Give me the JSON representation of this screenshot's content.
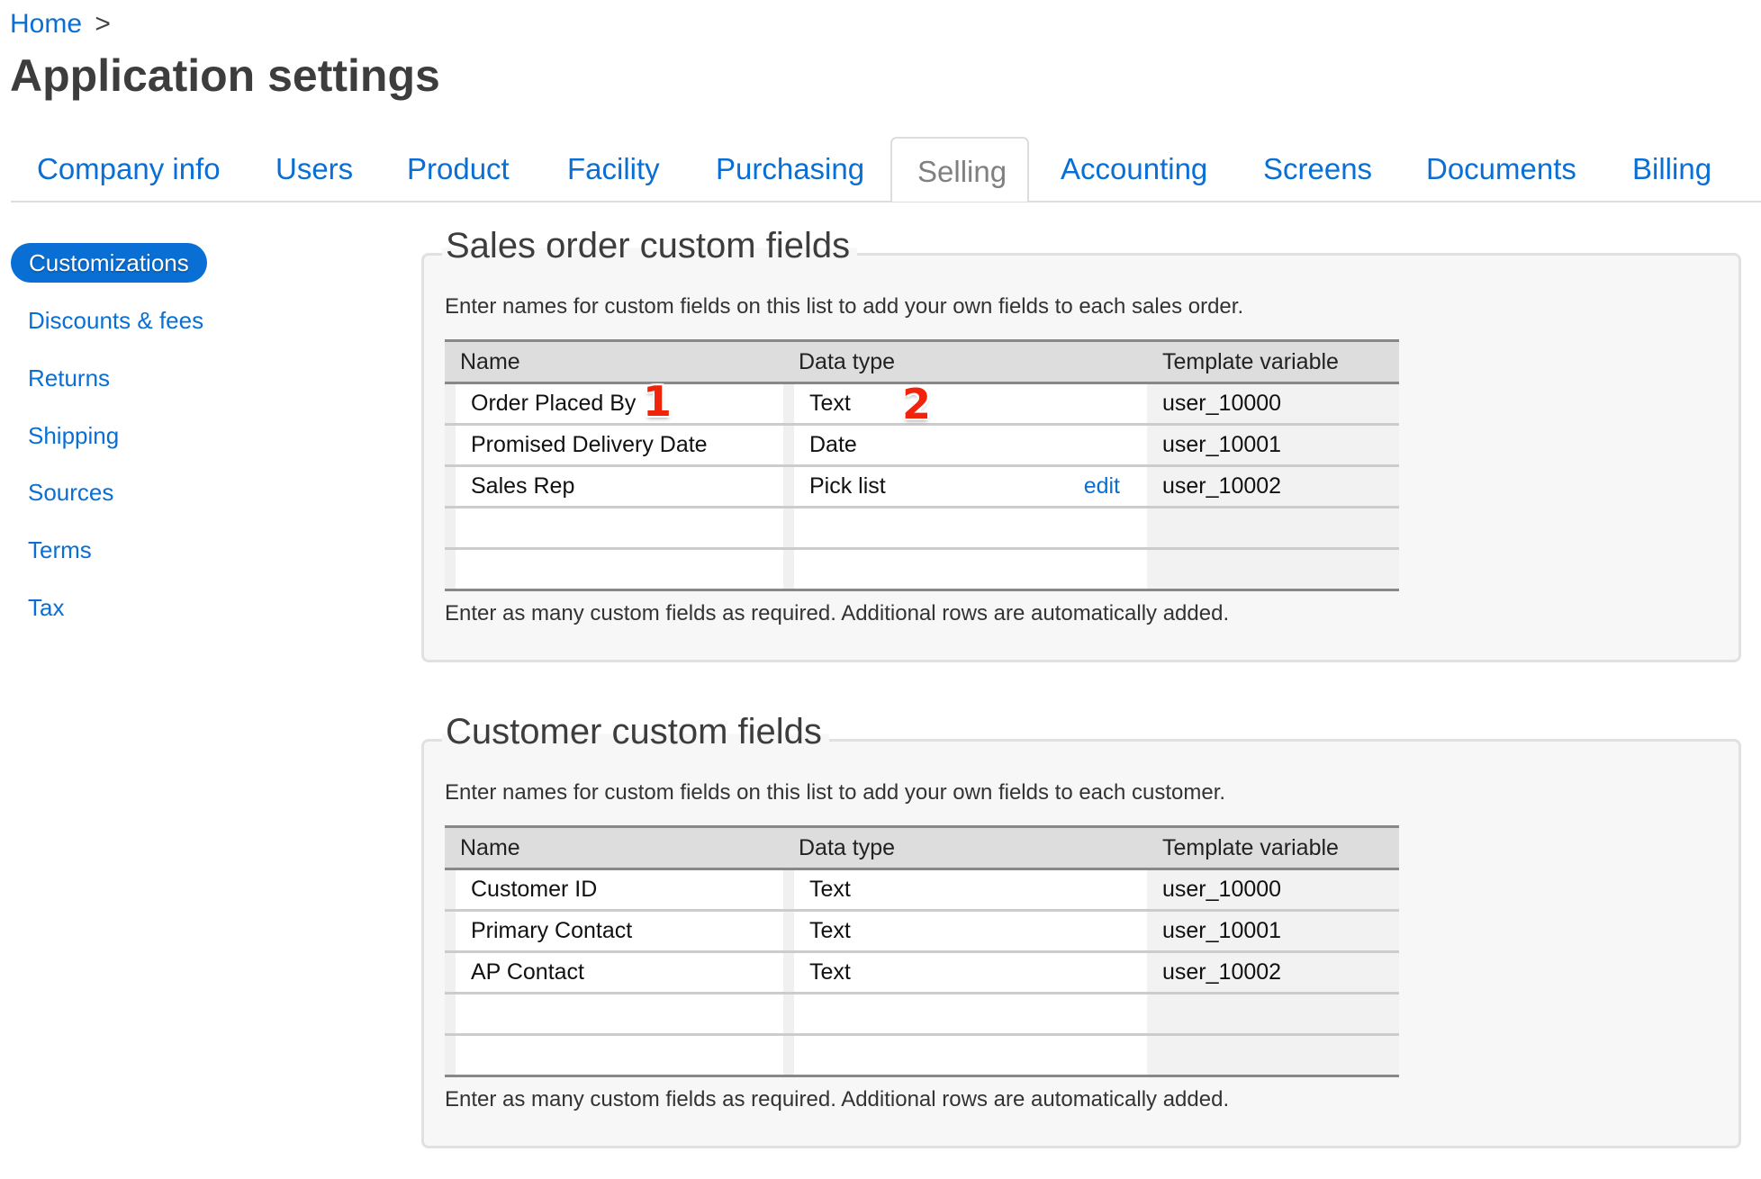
{
  "breadcrumb": {
    "home": "Home",
    "separator": ">"
  },
  "page_title": "Application settings",
  "tabs": [
    {
      "label": "Company info",
      "active": false
    },
    {
      "label": "Users",
      "active": false
    },
    {
      "label": "Product",
      "active": false
    },
    {
      "label": "Facility",
      "active": false
    },
    {
      "label": "Purchasing",
      "active": false
    },
    {
      "label": "Selling",
      "active": true
    },
    {
      "label": "Accounting",
      "active": false
    },
    {
      "label": "Screens",
      "active": false
    },
    {
      "label": "Documents",
      "active": false
    },
    {
      "label": "Billing",
      "active": false
    }
  ],
  "sidebar": {
    "items": [
      {
        "label": "Customizations",
        "active": true
      },
      {
        "label": "Discounts & fees",
        "active": false
      },
      {
        "label": "Returns",
        "active": false
      },
      {
        "label": "Shipping",
        "active": false
      },
      {
        "label": "Sources",
        "active": false
      },
      {
        "label": "Terms",
        "active": false
      },
      {
        "label": "Tax",
        "active": false
      }
    ]
  },
  "sales_order_fields": {
    "title": "Sales order custom fields",
    "description": "Enter names for custom fields on this list to add your own fields to each sales order.",
    "columns": {
      "name": "Name",
      "data_type": "Data type",
      "template_variable": "Template variable"
    },
    "rows": [
      {
        "name": "Order Placed By",
        "data_type": "Text",
        "template_variable": "user_10000",
        "edit": ""
      },
      {
        "name": "Promised Delivery Date",
        "data_type": "Date",
        "template_variable": "user_10001",
        "edit": ""
      },
      {
        "name": "Sales Rep",
        "data_type": "Pick list",
        "template_variable": "user_10002",
        "edit": "edit"
      },
      {
        "name": "",
        "data_type": "",
        "template_variable": "",
        "edit": ""
      },
      {
        "name": "",
        "data_type": "",
        "template_variable": "",
        "edit": ""
      }
    ],
    "footer": "Enter as many custom fields as required. Additional rows are automatically added."
  },
  "customer_fields": {
    "title": "Customer custom fields",
    "description": "Enter names for custom fields on this list to add your own fields to each customer.",
    "columns": {
      "name": "Name",
      "data_type": "Data type",
      "template_variable": "Template variable"
    },
    "rows": [
      {
        "name": "Customer ID",
        "data_type": "Text",
        "template_variable": "user_10000"
      },
      {
        "name": "Primary Contact",
        "data_type": "Text",
        "template_variable": "user_10001"
      },
      {
        "name": "AP Contact",
        "data_type": "Text",
        "template_variable": "user_10002"
      },
      {
        "name": "",
        "data_type": "",
        "template_variable": ""
      },
      {
        "name": "",
        "data_type": "",
        "template_variable": ""
      }
    ],
    "footer": "Enter as many custom fields as required. Additional rows are automatically added."
  },
  "annotations": [
    {
      "label": "1",
      "color": "#f1230a"
    },
    {
      "label": "2",
      "color": "#f1230a"
    }
  ],
  "colors": {
    "link": "#0a6fd4",
    "active_pill": "#0a6fd4",
    "annotation": "#f1230a"
  }
}
